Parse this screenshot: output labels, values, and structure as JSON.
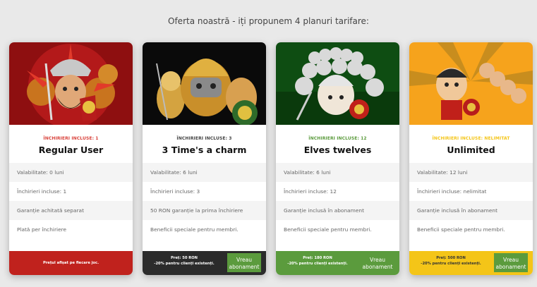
{
  "heading": "Oferta noastră - iți propunem 4 planuri tarifare:",
  "colors": {
    "red": "#c0221d",
    "dark": "#2b2b2b",
    "green": "#5b9b3d",
    "yellow": "#f4c518",
    "button": "#5b9b3d"
  },
  "plans": [
    {
      "badge": "ÎNCHIRIERI INCLUSE: 1",
      "title": "Regular User",
      "features": [
        "Valabilitate: 0 luni",
        "Închirieri incluse: 1",
        "Garanție achitată separat",
        "Plată per închiriere"
      ],
      "footer_line1": "Prețul afișat pe fiecare joc.",
      "footer_line2": "",
      "button": ""
    },
    {
      "badge": "ÎNCHIRIERI INCLUSE: 3",
      "title": "3 Time's a charm",
      "features": [
        "Valabilitate: 6 luni",
        "Închirieri incluse: 3",
        "50 RON garanție la prima închiriere",
        "Beneficii speciale pentru membri."
      ],
      "footer_line1": "Preț: 50 RON",
      "footer_line2": "-20% pentru clienți existenți.",
      "button": "Vreau abonament"
    },
    {
      "badge": "ÎNCHIRIERI INCLUSE: 12",
      "title": "Elves twelves",
      "features": [
        "Valabilitate: 6 luni",
        "Închirieri incluse: 12",
        "Garanție inclusă în abonament",
        "Beneficii speciale pentru membri."
      ],
      "footer_line1": "Preț: 180 RON",
      "footer_line2": "-20% pentru clienți existenți.",
      "button": "Vreau abonament"
    },
    {
      "badge": "ÎNCHIRIERI INCLUSE: NELIMITAT",
      "title": "Unlimited",
      "features": [
        "Valabilitate: 12 luni",
        "Închirieri incluse: nelimitat",
        "Garanție inclusă în abonament",
        "Beneficii speciale pentru membri."
      ],
      "footer_line1": "Preț: 500 RON",
      "footer_line2": "-20% pentru clienți existenți.",
      "button": "Vreau abonament"
    }
  ]
}
